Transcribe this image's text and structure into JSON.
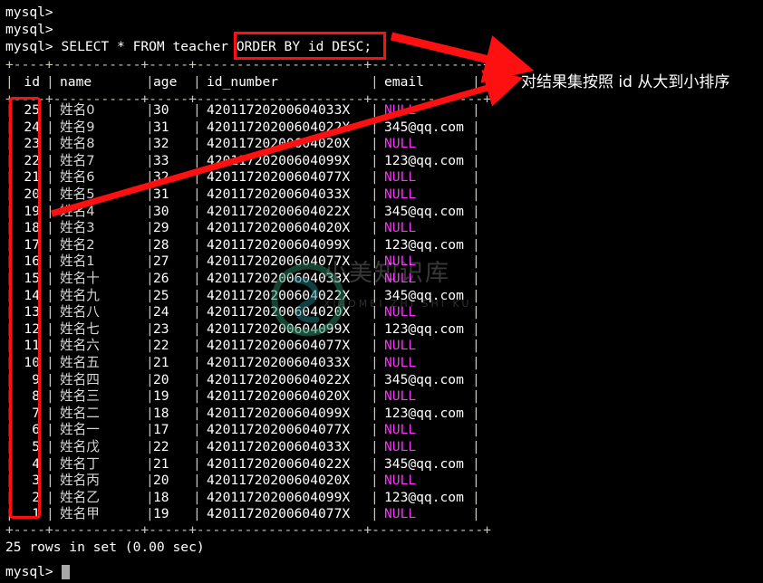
{
  "terminal": {
    "prompt": "mysql>",
    "blank_prompt_1": "mysql>",
    "blank_prompt_2": "mysql>",
    "command_prefix": "mysql> SELECT * FROM teacher ",
    "command_highlighted": "ORDER BY id DESC;",
    "full_command": "mysql> SELECT * FROM teacher ORDER BY id DESC;",
    "separator": "+----+-----------+-----+---------------------+--------------+",
    "result_status": "25 rows in set (0.00 sec)",
    "final_prompt": "mysql>",
    "colors": {
      "background": "#000000",
      "foreground": "#d8d8d8",
      "rule": "#c8c8b4",
      "null": "#ff2fff",
      "annotation_red": "#ff1010",
      "cursor": "#a8a8a8"
    }
  },
  "table": {
    "columns": [
      "id",
      "name",
      "age",
      "id_number",
      "email"
    ],
    "rows": [
      {
        "id": "25",
        "name": "姓名0",
        "age": "30",
        "id_number": "42011720200604033X",
        "email": "NULL"
      },
      {
        "id": "24",
        "name": "姓名9",
        "age": "31",
        "id_number": "42011720200604022X",
        "email": "345@qq.com"
      },
      {
        "id": "23",
        "name": "姓名8",
        "age": "32",
        "id_number": "42011720200604020X",
        "email": "NULL"
      },
      {
        "id": "22",
        "name": "姓名7",
        "age": "33",
        "id_number": "42011720200604099X",
        "email": "123@qq.com"
      },
      {
        "id": "21",
        "name": "姓名6",
        "age": "32",
        "id_number": "42011720200604077X",
        "email": "NULL"
      },
      {
        "id": "20",
        "name": "姓名5",
        "age": "31",
        "id_number": "42011720200604033X",
        "email": "NULL"
      },
      {
        "id": "19",
        "name": "姓名4",
        "age": "30",
        "id_number": "42011720200604022X",
        "email": "345@qq.com"
      },
      {
        "id": "18",
        "name": "姓名3",
        "age": "29",
        "id_number": "42011720200604020X",
        "email": "NULL"
      },
      {
        "id": "17",
        "name": "姓名2",
        "age": "28",
        "id_number": "42011720200604099X",
        "email": "123@qq.com"
      },
      {
        "id": "16",
        "name": "姓名1",
        "age": "27",
        "id_number": "42011720200604077X",
        "email": "NULL"
      },
      {
        "id": "15",
        "name": "姓名十",
        "age": "26",
        "id_number": "42011720200604033X",
        "email": "NULL"
      },
      {
        "id": "14",
        "name": "姓名九",
        "age": "25",
        "id_number": "42011720200604022X",
        "email": "345@qq.com"
      },
      {
        "id": "13",
        "name": "姓名八",
        "age": "24",
        "id_number": "42011720200604020X",
        "email": "NULL"
      },
      {
        "id": "12",
        "name": "姓名七",
        "age": "23",
        "id_number": "42011720200604099X",
        "email": "123@qq.com"
      },
      {
        "id": "11",
        "name": "姓名六",
        "age": "22",
        "id_number": "42011720200604077X",
        "email": "NULL"
      },
      {
        "id": "10",
        "name": "姓名五",
        "age": "21",
        "id_number": "42011720200604033X",
        "email": "NULL"
      },
      {
        "id": "9",
        "name": "姓名四",
        "age": "20",
        "id_number": "42011720200604022X",
        "email": "345@qq.com"
      },
      {
        "id": "8",
        "name": "姓名三",
        "age": "19",
        "id_number": "42011720200604020X",
        "email": "NULL"
      },
      {
        "id": "7",
        "name": "姓名二",
        "age": "18",
        "id_number": "42011720200604099X",
        "email": "123@qq.com"
      },
      {
        "id": "6",
        "name": "姓名一",
        "age": "17",
        "id_number": "42011720200604077X",
        "email": "NULL"
      },
      {
        "id": "5",
        "name": "姓名戊",
        "age": "22",
        "id_number": "42011720200604033X",
        "email": "NULL"
      },
      {
        "id": "4",
        "name": "姓名丁",
        "age": "21",
        "id_number": "42011720200604022X",
        "email": "345@qq.com"
      },
      {
        "id": "3",
        "name": "姓名丙",
        "age": "20",
        "id_number": "42011720200604020X",
        "email": "NULL"
      },
      {
        "id": "2",
        "name": "姓名乙",
        "age": "18",
        "id_number": "42011720200604099X",
        "email": "123@qq.com"
      },
      {
        "id": "1",
        "name": "姓名甲",
        "age": "19",
        "id_number": "42011720200604077X",
        "email": "NULL"
      }
    ]
  },
  "annotation": {
    "text": "对结果集按照 id 从大到小排序",
    "color": "#ffffff",
    "arrow_color": "#ff1010",
    "arrow_count": 2
  },
  "watermark": {
    "title": "小美知识库",
    "subtitle": "XIAOMEI ZHI SHI KU",
    "logo": "circular-swirl-logo"
  }
}
